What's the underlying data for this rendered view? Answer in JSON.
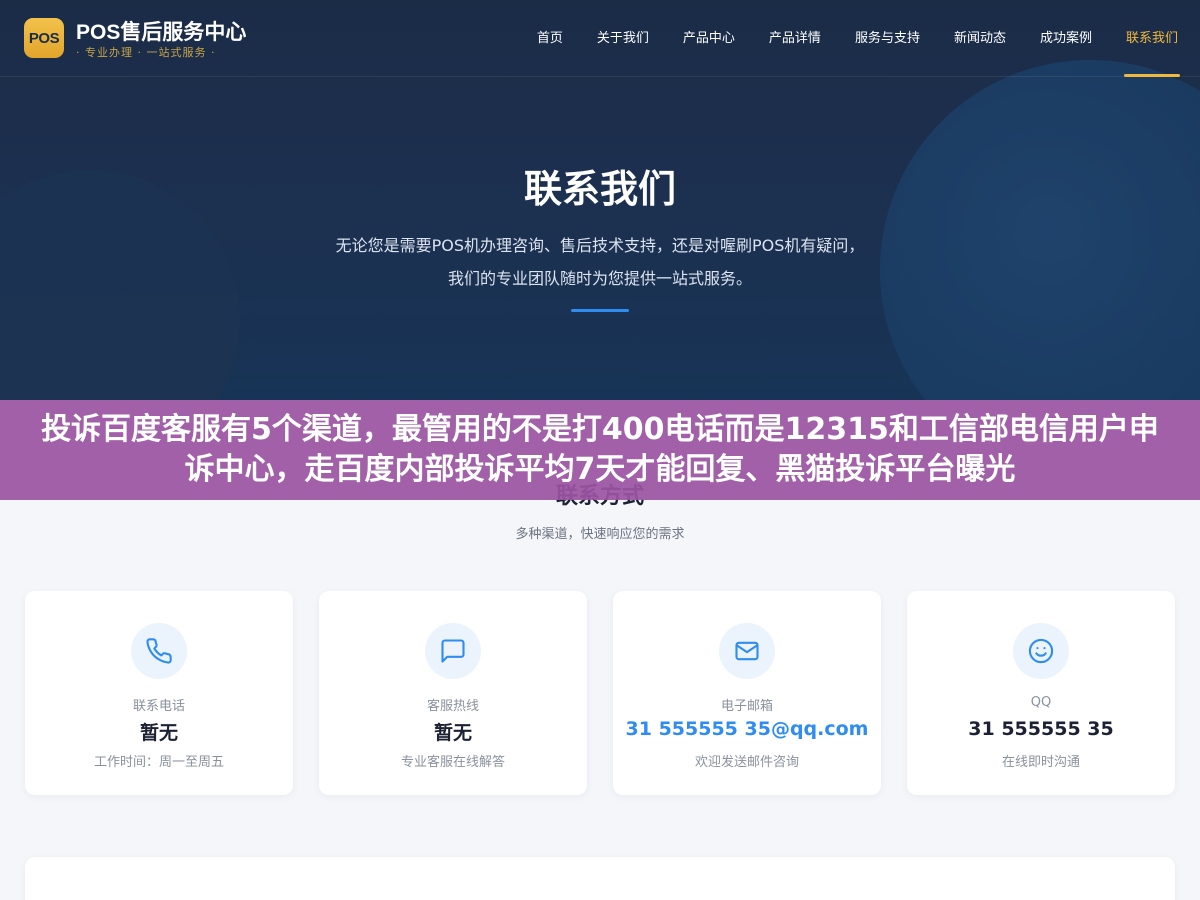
{
  "header": {
    "logo_text": "POS",
    "brand_title": "POS售后服务中心",
    "brand_subtitle": "· 专业办理 · 一站式服务 ·",
    "nav": [
      {
        "label": "首页"
      },
      {
        "label": "关于我们"
      },
      {
        "label": "产品中心"
      },
      {
        "label": "产品详情"
      },
      {
        "label": "服务与支持"
      },
      {
        "label": "新闻动态"
      },
      {
        "label": "成功案例"
      },
      {
        "label": "联系我们",
        "active": true
      }
    ]
  },
  "hero": {
    "title": "联系我们",
    "description_line1": "无论您是需要POS机办理咨询、售后技术支持，还是对喔刷POS机有疑问，",
    "description_line2": "我们的专业团队随时为您提供一站式服务。"
  },
  "banner": {
    "text": "投诉百度客服有5个渠道，最管用的不是打400电话而是12315和工信部电信用户申诉中心，走百度内部投诉平均7天才能回复、黑猫投诉平台曝光"
  },
  "contact": {
    "title": "联系方式",
    "subtitle": "多种渠道，快速响应您的需求",
    "cards": [
      {
        "icon": "phone-icon",
        "label": "联系电话",
        "value": "暂无",
        "note": "工作时间：周一至周五"
      },
      {
        "icon": "chat-icon",
        "label": "客服热线",
        "value": "暂无",
        "note": "专业客服在线解答"
      },
      {
        "icon": "mail-icon",
        "label": "电子邮箱",
        "value": "31 555555 35@qq.com",
        "note": "欢迎发送邮件咨询"
      },
      {
        "icon": "smile-icon",
        "label": "QQ",
        "value": "31 555555 35",
        "note": "在线即时沟通"
      }
    ]
  },
  "colors": {
    "accent": "#2f8cf0",
    "nav_active": "#f0b83c",
    "banner": "#9b54a2",
    "hero_bg": "#1b2c47"
  }
}
